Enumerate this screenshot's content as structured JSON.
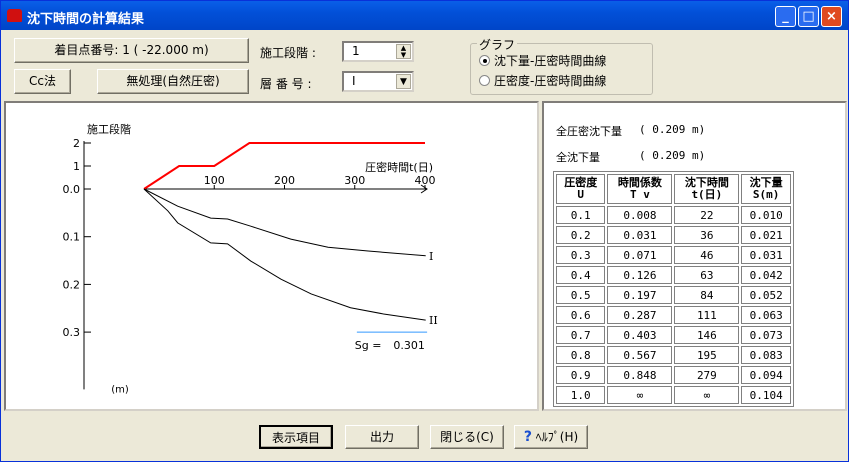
{
  "window": {
    "title": "沈下時間の計算結果",
    "minimize": "_",
    "maximize": "□",
    "close": "×"
  },
  "controls": {
    "point_button": "着目点番号: 1 ( -22.000 m)",
    "stage_label": "施工段階 :",
    "stage_value": "1",
    "method_button": "Cc法",
    "treatment_button": "無処理(自然圧密)",
    "layer_label": "層 番 号 :",
    "layer_value": "I"
  },
  "graph_group": {
    "title": "グラフ",
    "options": [
      {
        "label": "沈下量-圧密時間曲線",
        "selected": true
      },
      {
        "label": "圧密度-圧密時間曲線",
        "selected": false
      }
    ]
  },
  "summary": {
    "total_consolidation_label": "全圧密沈下量",
    "total_consolidation_value": "( 0.209 m)",
    "total_settlement_label": "全沈下量",
    "total_settlement_value": "( 0.209 m)"
  },
  "table": {
    "headers": [
      [
        "圧密度",
        "U"
      ],
      [
        "時間係数",
        "T v"
      ],
      [
        "沈下時間",
        "t(日)"
      ],
      [
        "沈下量",
        "S(m)"
      ]
    ],
    "rows": [
      [
        "0.1",
        "0.008",
        "22",
        "0.010"
      ],
      [
        "0.2",
        "0.031",
        "36",
        "0.021"
      ],
      [
        "0.3",
        "0.071",
        "46",
        "0.031"
      ],
      [
        "0.4",
        "0.126",
        "63",
        "0.042"
      ],
      [
        "0.5",
        "0.197",
        "84",
        "0.052"
      ],
      [
        "0.6",
        "0.287",
        "111",
        "0.063"
      ],
      [
        "0.7",
        "0.403",
        "146",
        "0.073"
      ],
      [
        "0.8",
        "0.567",
        "195",
        "0.083"
      ],
      [
        "0.9",
        "0.848",
        "279",
        "0.094"
      ],
      [
        "1.0",
        "∞",
        "∞",
        "0.104"
      ]
    ]
  },
  "footer": {
    "display_items": "表示項目",
    "output": "出力",
    "close": "閉じる(C)",
    "help": "ﾍﾙﾌﾟ(H)"
  },
  "chart_data": {
    "type": "line",
    "xlabel": "圧密時間t(日)",
    "stage_label": "施工段階",
    "unit_label": "(m)",
    "x_ticks": [
      "100",
      "200",
      "300",
      "400"
    ],
    "stage_ticks": [
      "2",
      "1"
    ],
    "y_ticks": [
      "0.0",
      "0.1",
      "0.2",
      "0.3"
    ],
    "xlim": [
      0,
      400
    ],
    "ylim": [
      0,
      0.42
    ],
    "stage_series": {
      "x": [
        0,
        50,
        100,
        150,
        400
      ],
      "y": [
        0,
        1,
        1,
        2,
        2
      ],
      "color": "#ff0000"
    },
    "series": [
      {
        "name": "I",
        "t": [
          0,
          48,
          95,
          119,
          152,
          209,
          262,
          319,
          401
        ],
        "s": [
          0,
          0.036,
          0.061,
          0.063,
          0.078,
          0.105,
          0.122,
          0.13,
          0.14
        ]
      },
      {
        "name": "II",
        "t": [
          0,
          34,
          48,
          95,
          119,
          152,
          195,
          238,
          294,
          341,
          401
        ],
        "s": [
          0,
          0.046,
          0.071,
          0.113,
          0.115,
          0.151,
          0.189,
          0.22,
          0.249,
          0.262,
          0.275
        ]
      }
    ],
    "sg_label": "Sg =",
    "sg_value": "0.301",
    "sg_line_color": "#3399ff"
  }
}
